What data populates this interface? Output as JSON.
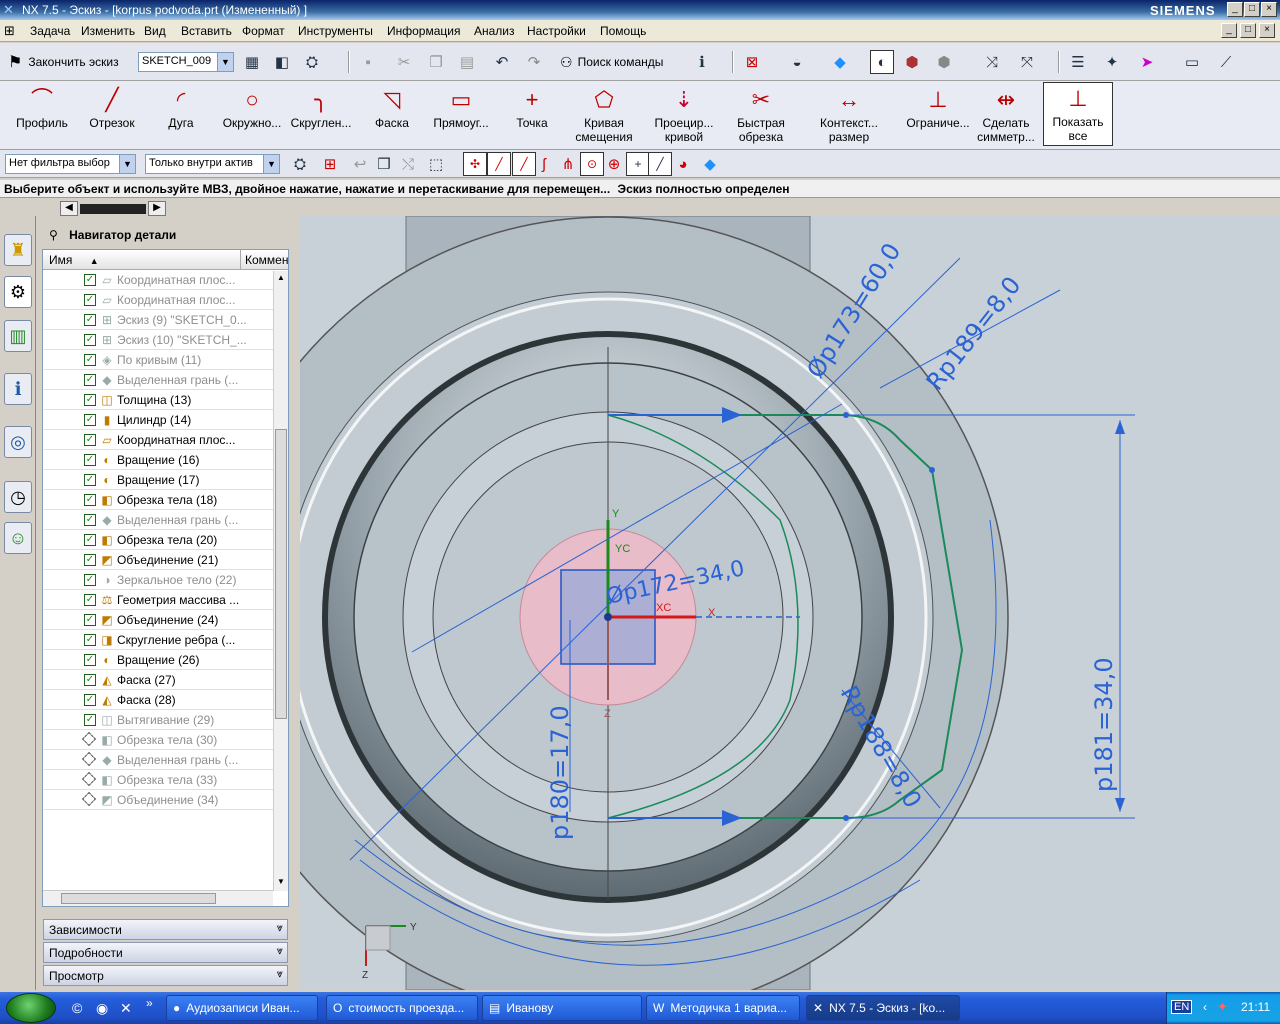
{
  "window": {
    "title": "NX 7.5 - Эскиз - [korpus podvoda.prt (Измененный) ]",
    "brand": "SIEMENS",
    "minimize": "_",
    "maximize": "□",
    "close": "×"
  },
  "menu": [
    "Задача",
    "Изменить",
    "Вид",
    "Вставить",
    "Формат",
    "Инструменты",
    "Информация",
    "Анализ",
    "Настройки",
    "Помощь"
  ],
  "toolbar": {
    "finish_sketch": "Закончить эскиз",
    "sketch_name": "SKETCH_009",
    "find_command": "Поиск команды"
  },
  "sketch_tools": [
    {
      "label": "Профиль",
      "icon": "⌒"
    },
    {
      "label": "Отрезок",
      "icon": "╱"
    },
    {
      "label": "Дуга",
      "icon": "◜"
    },
    {
      "label": "Окружно...",
      "icon": "○"
    },
    {
      "label": "Скруглен...",
      "icon": "╮"
    },
    {
      "label": "Фаска",
      "icon": "◹"
    },
    {
      "label": "Прямоуг...",
      "icon": "▭"
    },
    {
      "label": "Точка",
      "icon": "+"
    },
    {
      "label": "Кривая\nсмещения",
      "icon": "⬠"
    },
    {
      "label": "Проецир...\nкривой",
      "icon": "⇣"
    },
    {
      "label": "Быстрая\nобрезка",
      "icon": "✂"
    },
    {
      "label": "Контекст...\nразмер",
      "icon": "↔"
    },
    {
      "label": "Ограниче...",
      "icon": "⊥"
    },
    {
      "label": "Сделать\nсимметр...",
      "icon": "⇹"
    },
    {
      "label": "Показать\nвсе",
      "icon": "⊥"
    }
  ],
  "filters": {
    "type_filter": "Нет фильтра выбор",
    "scope_filter": "Только внутри актив"
  },
  "status": {
    "prompt": "Выберите объект и используйте МВЗ, двойное нажатие, нажатие и перетаскивание для перемещен...",
    "state": "Эскиз полностью определен"
  },
  "navigator": {
    "title": "Навигатор детали",
    "col_name": "Имя",
    "col_comment": "Коммен",
    "rows": [
      {
        "label": "Координатная плос...",
        "icon": "▱",
        "dim": true
      },
      {
        "label": "Координатная плос...",
        "icon": "▱",
        "dim": true
      },
      {
        "label": "Эскиз (9) \"SKETCH_0...",
        "icon": "⊞",
        "dim": true
      },
      {
        "label": "Эскиз (10) \"SKETCH_...",
        "icon": "⊞",
        "dim": true
      },
      {
        "label": "По кривым (11)",
        "icon": "◈",
        "dim": true
      },
      {
        "label": "Выделенная грань (...",
        "icon": "◆",
        "dim": true
      },
      {
        "label": "Толщина (13)",
        "icon": "◫",
        "dim": false
      },
      {
        "label": "Цилиндр (14)",
        "icon": "▮",
        "dim": false
      },
      {
        "label": "Координатная плос...",
        "icon": "▱",
        "dim": false
      },
      {
        "label": "Вращение (16)",
        "icon": "◐",
        "dim": false
      },
      {
        "label": "Вращение (17)",
        "icon": "◐",
        "dim": false
      },
      {
        "label": "Обрезка тела (18)",
        "icon": "◧",
        "dim": false
      },
      {
        "label": "Выделенная грань (...",
        "icon": "◆",
        "dim": true
      },
      {
        "label": "Обрезка тела (20)",
        "icon": "◧",
        "dim": false
      },
      {
        "label": "Объединение (21)",
        "icon": "◩",
        "dim": false
      },
      {
        "label": "Зеркальное тело (22)",
        "icon": "◑",
        "dim": true
      },
      {
        "label": "Геометрия массива ...",
        "icon": "⚖",
        "dim": false
      },
      {
        "label": "Объединение (24)",
        "icon": "◩",
        "dim": false
      },
      {
        "label": "Скругление ребра (...",
        "icon": "◨",
        "dim": false
      },
      {
        "label": "Вращение (26)",
        "icon": "◐",
        "dim": false
      },
      {
        "label": "Фаска (27)",
        "icon": "◭",
        "dim": false
      },
      {
        "label": "Фаска (28)",
        "icon": "◭",
        "dim": false
      },
      {
        "label": "Вытягивание (29)",
        "icon": "◫",
        "dim": true
      },
      {
        "label": "Обрезка тела (30)",
        "icon": "◧",
        "dim": true
      },
      {
        "label": "Выделенная грань (...",
        "icon": "◆",
        "dim": true
      },
      {
        "label": "Обрезка тела (33)",
        "icon": "◧",
        "dim": true
      },
      {
        "label": "Объединение (34)",
        "icon": "◩",
        "dim": true
      }
    ],
    "sections": [
      "Зависимости",
      "Подробности",
      "Просмотр"
    ]
  },
  "dimensions": {
    "d1": "Øp173=60,0",
    "d2": "Rp189=8,0",
    "d3": "Øp172=34,0",
    "d4": "p181=34,0",
    "d5": "p180=17,0",
    "d6": "Rp188=8,0"
  },
  "axes": {
    "x": "X",
    "y": "Y",
    "z": "Z",
    "xc": "XC",
    "yc": "YC"
  },
  "taskbar": {
    "tasks": [
      {
        "label": "Аудиозаписи Иван...",
        "icon": "●"
      },
      {
        "label": "стоимость проезда...",
        "icon": "O"
      },
      {
        "label": "Иванову",
        "icon": "▤"
      },
      {
        "label": "Методичка 1 вариа...",
        "icon": "W"
      },
      {
        "label": "NX 7.5 - Эскиз - [ko...",
        "icon": "✕"
      }
    ],
    "lang": "EN",
    "clock": "21:11"
  },
  "colors": {
    "accent_blue": "#2a63d4",
    "sketch_green": "#1b8a5a",
    "model_gray": "#aab4bc"
  }
}
